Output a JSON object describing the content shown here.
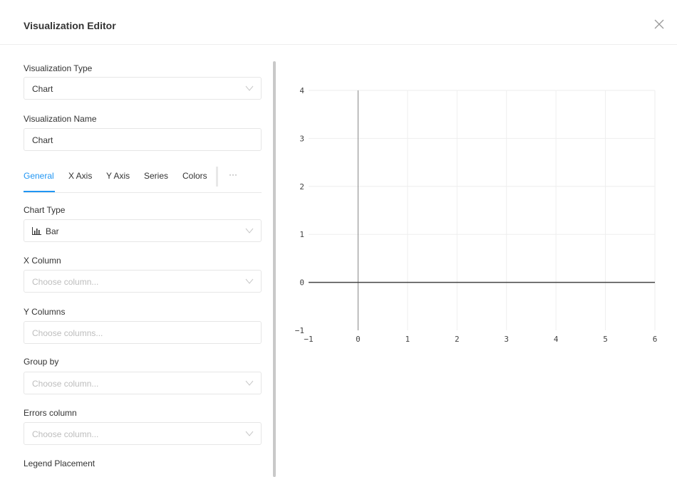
{
  "header": {
    "title": "Visualization Editor",
    "close_icon": "close-icon"
  },
  "form": {
    "visualization_type": {
      "label": "Visualization Type",
      "value": "Chart"
    },
    "visualization_name": {
      "label": "Visualization Name",
      "value": "Chart"
    },
    "tabs": [
      {
        "label": "General",
        "active": true
      },
      {
        "label": "X Axis",
        "active": false
      },
      {
        "label": "Y Axis",
        "active": false
      },
      {
        "label": "Series",
        "active": false
      },
      {
        "label": "Colors",
        "active": false
      }
    ],
    "more_label": "···",
    "chart_type": {
      "label": "Chart Type",
      "value": "Bar",
      "icon": "bar-chart-icon"
    },
    "x_column": {
      "label": "X Column",
      "placeholder": "Choose column..."
    },
    "y_columns": {
      "label": "Y Columns",
      "placeholder": "Choose columns..."
    },
    "group_by": {
      "label": "Group by",
      "placeholder": "Choose column..."
    },
    "errors_column": {
      "label": "Errors column",
      "placeholder": "Choose column..."
    },
    "legend_placement": {
      "label": "Legend Placement"
    }
  },
  "colors": {
    "accent": "#2196f3",
    "border": "#e6e6e6",
    "grid": "#eeeeee",
    "zeroline": "#444444"
  },
  "chart_data": {
    "type": "bar",
    "title": "",
    "xlabel": "",
    "ylabel": "",
    "series": [],
    "xlim": [
      -1,
      6
    ],
    "ylim": [
      -1,
      4
    ],
    "x_ticks": [
      "−1",
      "0",
      "1",
      "2",
      "3",
      "4",
      "5",
      "6"
    ],
    "y_ticks": [
      "−1",
      "0",
      "1",
      "2",
      "3",
      "4"
    ],
    "grid": true
  }
}
